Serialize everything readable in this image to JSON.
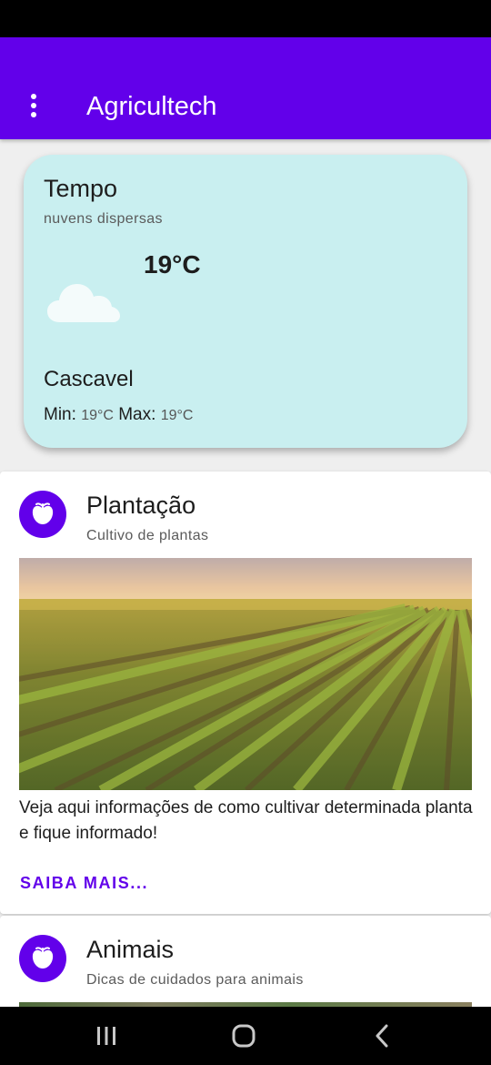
{
  "app_bar": {
    "title": "Agricultech",
    "menu_icon": "more-vert-icon",
    "background": "#6200ea"
  },
  "weather": {
    "title": "Tempo",
    "description": "nuvens dispersas",
    "icon": "cloud-icon",
    "temperature": "19°C",
    "city": "Cascavel",
    "min_label": "Min:",
    "min_value": "19°C",
    "max_label": "Max:",
    "max_value": "19°C",
    "background": "#c9eff0"
  },
  "cards": [
    {
      "icon": "fruit-icon",
      "title": "Plantação",
      "subtitle": "Cultivo de plantas",
      "image": "crop-field-image",
      "text": "Veja aqui informações de como cultivar determinada planta e fique informado!",
      "action": "SAIBA MAIS..."
    },
    {
      "icon": "fruit-icon",
      "title": "Animais",
      "subtitle": "Dicas de cuidados para animais",
      "image": "animals-image"
    }
  ],
  "nav_bar": {
    "recent_icon": "recent-apps-icon",
    "home_icon": "home-icon",
    "back_icon": "back-icon"
  },
  "colors": {
    "accent": "#6200ea",
    "status_bar": "#000000"
  }
}
